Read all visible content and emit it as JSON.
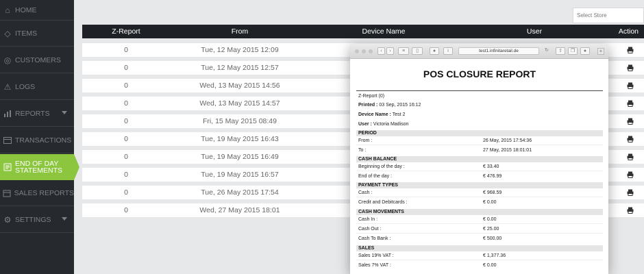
{
  "sidebar": {
    "items": [
      {
        "label": "HOME",
        "icon": "home-icon"
      },
      {
        "label": "ITEMS",
        "icon": "tag-icon"
      },
      {
        "label": "CUSTOMERS",
        "icon": "customers-icon"
      },
      {
        "label": "LOGS",
        "icon": "warning-icon"
      },
      {
        "label": "REPORTS",
        "icon": "bar-chart-icon"
      },
      {
        "label": "TRANSACTIONS",
        "icon": "credit-card-icon"
      },
      {
        "label": "END OF DAY",
        "label2": "STATEMENTS",
        "icon": "statement-icon"
      },
      {
        "label": "SALES REPORTS",
        "icon": "calendar-icon"
      },
      {
        "label": "SETTINGS",
        "icon": "gear-icon"
      }
    ]
  },
  "store_select": {
    "placeholder": "Select Store"
  },
  "table": {
    "headers": {
      "z": "Z-Report",
      "from": "From",
      "device": "Device Name",
      "user": "User",
      "action": "Action"
    },
    "rows": [
      {
        "z": "0",
        "from": "Tue, 12 May 2015 12:09"
      },
      {
        "z": "0",
        "from": "Tue, 12 May 2015 12:57"
      },
      {
        "z": "0",
        "from": "Wed, 13 May 2015 14:56"
      },
      {
        "z": "0",
        "from": "Wed, 13 May 2015 14:57"
      },
      {
        "z": "0",
        "from": "Fri, 15 May 2015 08:49"
      },
      {
        "z": "0",
        "from": "Tue, 19 May 2015 16:43"
      },
      {
        "z": "0",
        "from": "Tue, 19 May 2015 16:49"
      },
      {
        "z": "0",
        "from": "Tue, 19 May 2015 16:57"
      },
      {
        "z": "0",
        "from": "Tue, 26 May 2015 17:54"
      },
      {
        "z": "0",
        "from": "Wed, 27 May 2015 18:01"
      }
    ]
  },
  "browser": {
    "url": "test1.infinitaretail.de",
    "report": {
      "title": "POS CLOSURE REPORT",
      "z_report": "Z-Report (0)",
      "printed_label": "Printed :",
      "printed_value": "03 Sep, 2015 16:12",
      "device_label": "Device Name :",
      "device_value": "Test 2",
      "user_label": "User :",
      "user_value": "Victoria Madison",
      "sections": {
        "period": {
          "title": "PERIOD",
          "rows": [
            {
              "k": "From :",
              "v": "26 May, 2015 17:54:36"
            },
            {
              "k": "To :",
              "v": "27 May, 2015 18:01:01"
            }
          ]
        },
        "cash_balance": {
          "title": "CASH BALANCE",
          "rows": [
            {
              "k": "Beginning of the day :",
              "v": "€ 33.40"
            },
            {
              "k": "End of the day :",
              "v": "€ 476.99"
            }
          ]
        },
        "payment_types": {
          "title": "PAYMENT TYPES",
          "rows": [
            {
              "k": "Cash :",
              "v": "€ 968.59"
            },
            {
              "k": "Credit and Debitcards :",
              "v": "€ 0.00"
            }
          ]
        },
        "cash_movements": {
          "title": "CASH MOVEMENTS",
          "rows": [
            {
              "k": "Cash In :",
              "v": "€ 0.00"
            },
            {
              "k": "Cash Out :",
              "v": "€ 25.00"
            },
            {
              "k": "Cash To Bank :",
              "v": "€ 500.00"
            }
          ]
        },
        "sales": {
          "title": "SALES",
          "rows": [
            {
              "k": "Sales 19% VAT :",
              "v": "€ 1,377.36"
            },
            {
              "k": "Sales 7% VAT :",
              "v": "€ 0.00"
            }
          ]
        }
      }
    }
  }
}
